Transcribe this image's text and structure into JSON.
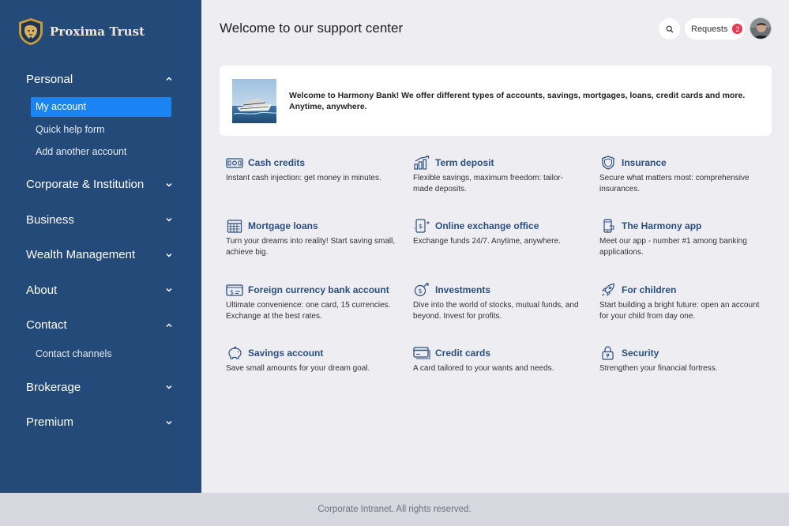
{
  "brand": {
    "name": "Proxima Trust",
    "logo_icon": "lion-shield-icon"
  },
  "sidebar": {
    "groups": [
      {
        "label": "Personal",
        "expanded": true,
        "items": [
          {
            "label": "My account",
            "active": true
          },
          {
            "label": "Quick help form"
          },
          {
            "label": "Add another account"
          }
        ]
      },
      {
        "label": "Corporate & Institution",
        "expanded": false
      },
      {
        "label": "Business",
        "expanded": false
      },
      {
        "label": "Wealth Management",
        "expanded": false
      },
      {
        "label": "About",
        "expanded": false
      },
      {
        "label": "Contact",
        "expanded": true,
        "items": [
          {
            "label": "Contact channels"
          }
        ]
      },
      {
        "label": "Brokerage",
        "expanded": false
      },
      {
        "label": "Premium",
        "expanded": false
      }
    ]
  },
  "header": {
    "title": "Welcome to our support center",
    "requests_label": "Requests",
    "requests_count": "2"
  },
  "welcome": {
    "text": "Welcome to Harmony Bank! We offer different types of accounts, savings, mortgages, loans, credit cards and more. Anytime, anywhere."
  },
  "services": [
    {
      "title": "Cash credits",
      "desc": "Instant cash injection: get money in minutes.",
      "icon": "cash-icon"
    },
    {
      "title": "Term deposit",
      "desc": "Flexible savings, maximum freedom: tailor-made deposits.",
      "icon": "growth-chart-icon"
    },
    {
      "title": "Insurance",
      "desc": "Secure what matters most: comprehensive insurances.",
      "icon": "shield-icon"
    },
    {
      "title": "Mortgage loans",
      "desc": "Turn your dreams into reality! Start saving small, achieve big.",
      "icon": "house-icon"
    },
    {
      "title": "Online exchange office",
      "desc": "Exchange funds 24/7. Anytime, anywhere.",
      "icon": "exchange-icon"
    },
    {
      "title": "The Harmony app",
      "desc": "Meet our app - number #1 among banking applications.",
      "icon": "phone-icon"
    },
    {
      "title": "Foreign currency bank account",
      "desc": "Ultimate convenience: one card, 15 currencies. Exchange at the best rates.",
      "icon": "dollar-card-icon"
    },
    {
      "title": "Investments",
      "desc": "Dive into the world of stocks, mutual funds, and beyond. Invest for profits.",
      "icon": "investment-icon"
    },
    {
      "title": "For children",
      "desc": "Start building a bright future: open an account for your child from day one.",
      "icon": "rocket-icon"
    },
    {
      "title": "Savings account",
      "desc": "Save small amounts for your dream goal.",
      "icon": "piggy-bank-icon"
    },
    {
      "title": "Credit cards",
      "desc": "A card tailored to your wants and needs.",
      "icon": "credit-card-icon"
    },
    {
      "title": "Security",
      "desc": "Strengthen your financial fortress.",
      "icon": "lock-icon"
    }
  ],
  "footer": {
    "text": "Corporate Intranet. All rights reserved."
  },
  "colors": {
    "sidebar": "#244a79",
    "active": "#1a84f5",
    "badge": "#e8384f",
    "link": "#2b4f7e"
  }
}
